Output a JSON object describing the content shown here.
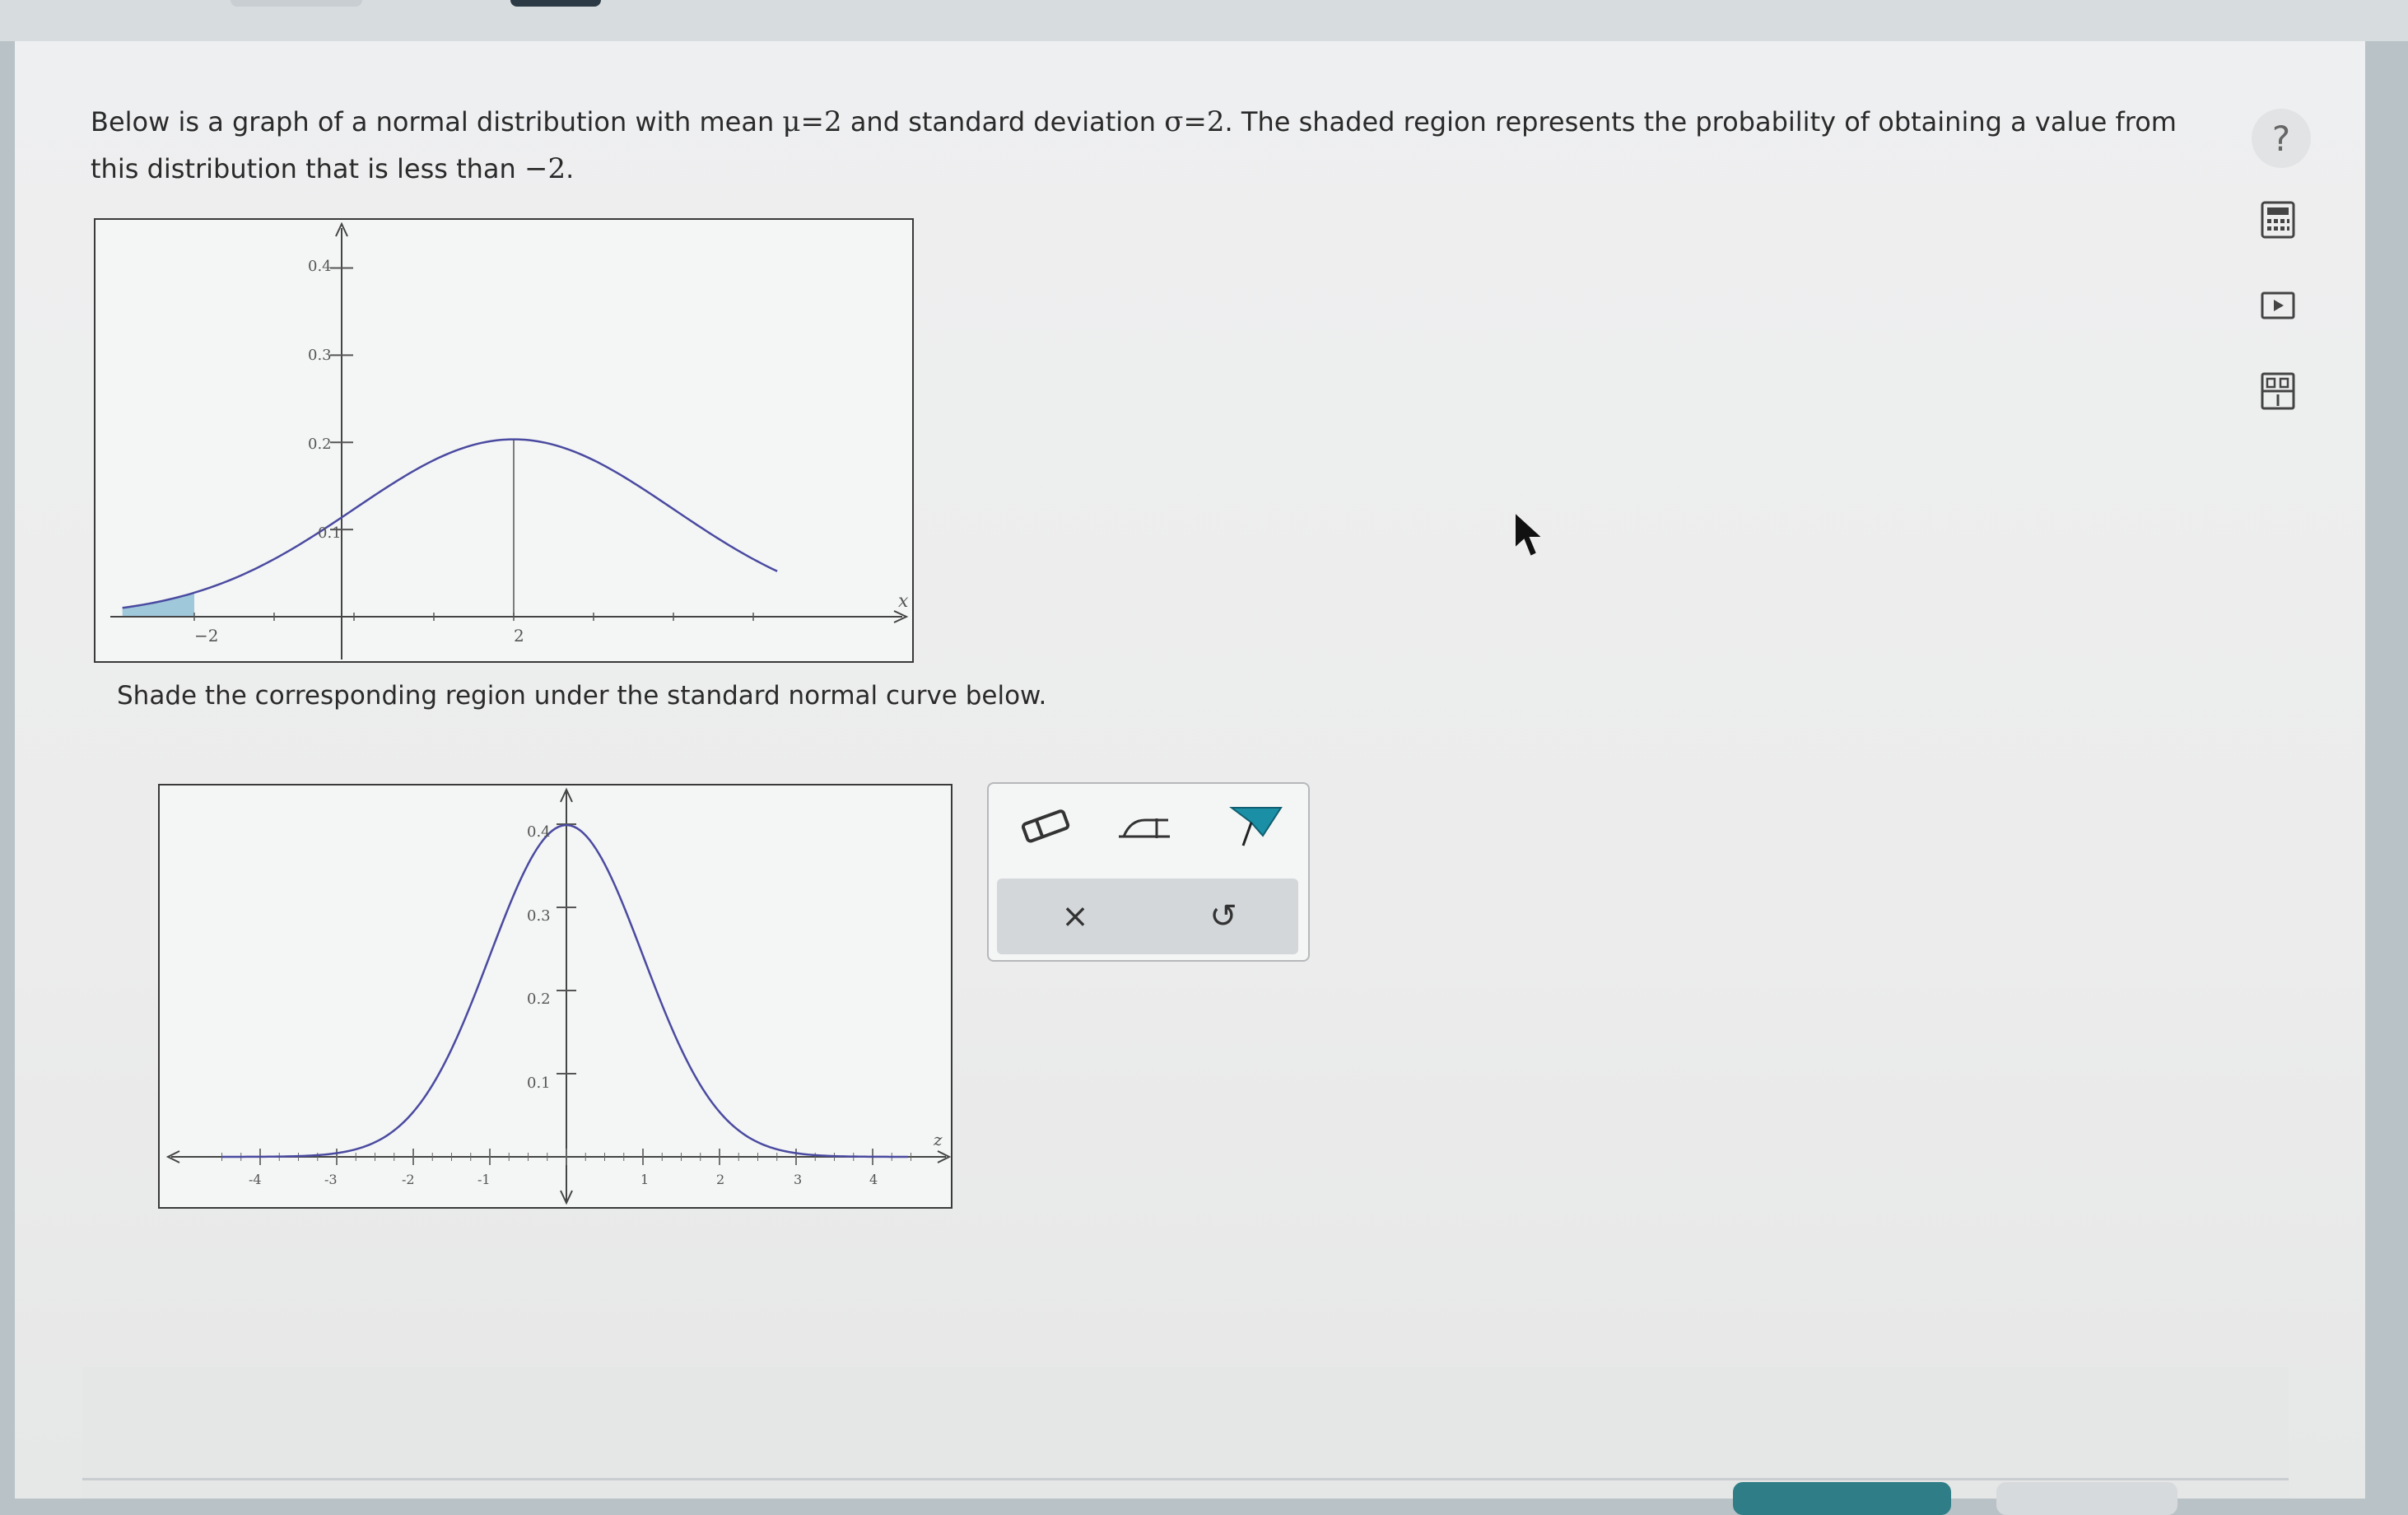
{
  "question": {
    "text_before_mu": "Below is a graph of a normal distribution with mean ",
    "mu": "μ=2",
    "text_after_mu": " and standard deviation ",
    "sigma": "σ=2",
    "text_after_sigma": ". The shaded region represents the probability of obtaining a value from this distribution that is less than ",
    "value": "−2",
    "period": "."
  },
  "instruction": "Shade the corresponding region under the standard normal curve below.",
  "chart_data": [
    {
      "type": "area",
      "distribution": "normal",
      "mean": 2,
      "sd": 2,
      "shaded_region": {
        "from": "-inf",
        "to": -2
      },
      "xlabel": "x",
      "x_ticks": [
        "−2",
        "2"
      ],
      "y_ticks": [
        "0.4",
        "0.3",
        "0.2",
        "0.1"
      ],
      "colors": {
        "curve": "#4a4aa0",
        "shade": "#8fbfd6"
      }
    },
    {
      "type": "line",
      "distribution": "standard normal",
      "mean": 0,
      "sd": 1,
      "xlabel": "z",
      "xlim": [
        -4.5,
        4.5
      ],
      "x_ticks": [
        "-4",
        "-3",
        "-2",
        "-1",
        "1",
        "2",
        "3",
        "4"
      ],
      "y_ticks": [
        "0.4",
        "0.3",
        "0.2",
        "0.1"
      ],
      "colors": {
        "curve": "#4a4aa0"
      }
    }
  ],
  "toolbox": {
    "tools": [
      "eraser-icon",
      "shade-tool-icon",
      "flag-icon"
    ],
    "actions": {
      "clear": "×",
      "undo": "↺"
    },
    "accent": "#1b8fa6"
  },
  "sidebar": {
    "help": "?",
    "icons": [
      "calculator-icon",
      "video-icon",
      "ebook-icon"
    ]
  }
}
